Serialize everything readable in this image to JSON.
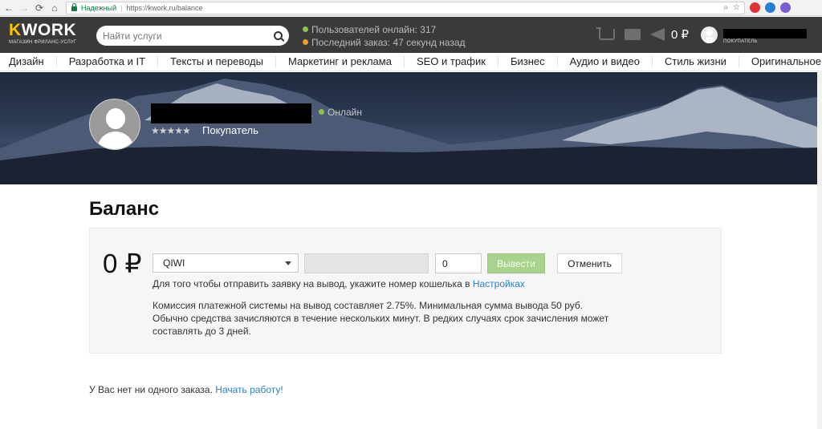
{
  "browser": {
    "secure_label": "Надежный",
    "url": "https://kwork.ru/balance"
  },
  "header": {
    "logo_text": "WORK",
    "logo_k": "K",
    "logo_subtitle": "МАГАЗИН ФРИЛАНС-УСЛУГ",
    "search_placeholder": "Найти услуги",
    "online_users": "Пользователей онлайн: 317",
    "last_order": "Последний заказ: 47 секунд назад",
    "balance": "0 ₽",
    "user_role": "ПОКУПАТЕЛЬ"
  },
  "categories": [
    "Дизайн",
    "Разработка и IT",
    "Тексты и переводы",
    "Маркетинг и реклама",
    "SEO и трафик",
    "Бизнес",
    "Аудио и видео",
    "Стиль жизни",
    "Оригинальное"
  ],
  "profile": {
    "status": "Онлайн",
    "stars": "★★★★★",
    "role": "Покупатель"
  },
  "balance_page": {
    "title": "Баланс",
    "amount": "0 ₽",
    "method": "QIWI",
    "amount_value": "0",
    "withdraw_label": "Вывести",
    "cancel_label": "Отменить",
    "hint_text": "Для того чтобы отправить заявку на вывод, укажите номер кошелька в ",
    "hint_link": "Настройках",
    "info_line1": "Комиссия платежной системы на вывод составляет 2.75%. Минимальная сумма вывода 50 руб.",
    "info_line2": "Обычно средства зачисляются в течение нескольких минут. В редких случаях срок зачисления может составлять до 3 дней.",
    "no_orders_text": "У Вас нет ни одного заказа. ",
    "no_orders_link": "Начать работу!"
  },
  "colors": {
    "header_bg": "#3a3a3a",
    "accent": "#ffc400",
    "link": "#2f7fc0",
    "withdraw_btn": "#a9d28e",
    "online_dot": "#8bc34a"
  }
}
